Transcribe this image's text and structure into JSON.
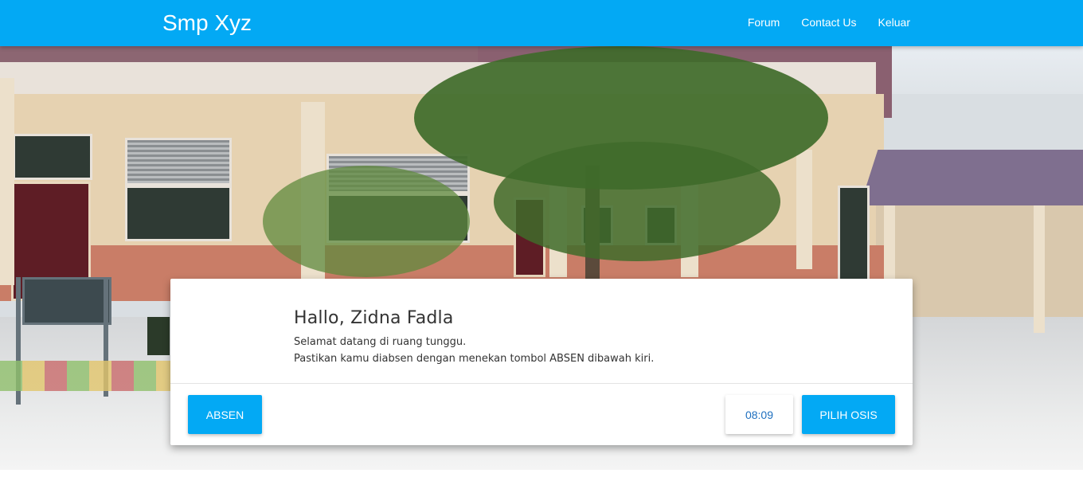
{
  "navbar": {
    "brand": "Smp Xyz",
    "links": [
      {
        "label": "Forum"
      },
      {
        "label": "Contact Us"
      },
      {
        "label": "Keluar"
      }
    ]
  },
  "card": {
    "greeting": "Hallo, Zidna Fadla",
    "line1": "Selamat datang di ruang tunggu.",
    "line2": "Pastikan kamu diabsen dengan menekan tombol ABSEN dibawah kiri.",
    "absen_label": "ABSEN",
    "time_label": "08:09",
    "pilih_osis_label": "PILIH OSIS"
  },
  "colors": {
    "primary": "#03a9f4"
  },
  "hero": {
    "image": "school-building-photo"
  }
}
